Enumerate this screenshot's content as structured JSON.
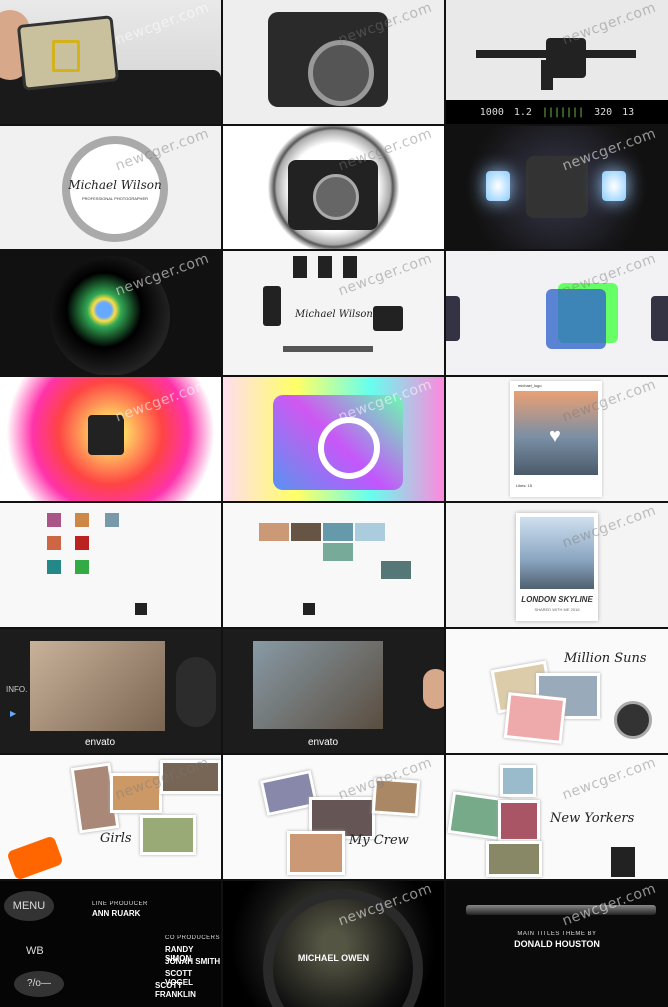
{
  "watermark": "newcger.com",
  "hud": {
    "shutter": "1000",
    "aperture": "1.2",
    "iso": "320",
    "shots": "13"
  },
  "logo": {
    "name": "Michael Wilson",
    "tagline": "PROFESSIONAL PHOTOGRAPHER"
  },
  "social": {
    "handle": "michael_lugo",
    "likes": "Likes: 15"
  },
  "polaroid": {
    "title": "LONDON SKYLINE",
    "subtitle": "SHARED WITH ME 2016"
  },
  "screen": {
    "labels": [
      "INFO.",
      "▶"
    ],
    "brand": "envato"
  },
  "albums": {
    "a": "Million Suns",
    "b": "Girls",
    "c": "My Crew",
    "d": "New Yorkers"
  },
  "keys": {
    "menu": "MENU",
    "wb": "WB",
    "lock": "?/o—"
  },
  "credits": {
    "line_producer_label": "LINE PRODUCER",
    "line_producer": "ANN RUARK",
    "coproducers_label": "CO PRODUCERS",
    "coproducers": [
      "RANDY SIMON",
      "JONAH SMITH",
      "SCOTT VOGEL",
      "SCOTT FRANKLIN"
    ],
    "center_name": "MICHAEL OWEN",
    "main_titles_label": "MAIN TITLES THEME BY",
    "main_titles": "DONALD HOUSTON"
  }
}
